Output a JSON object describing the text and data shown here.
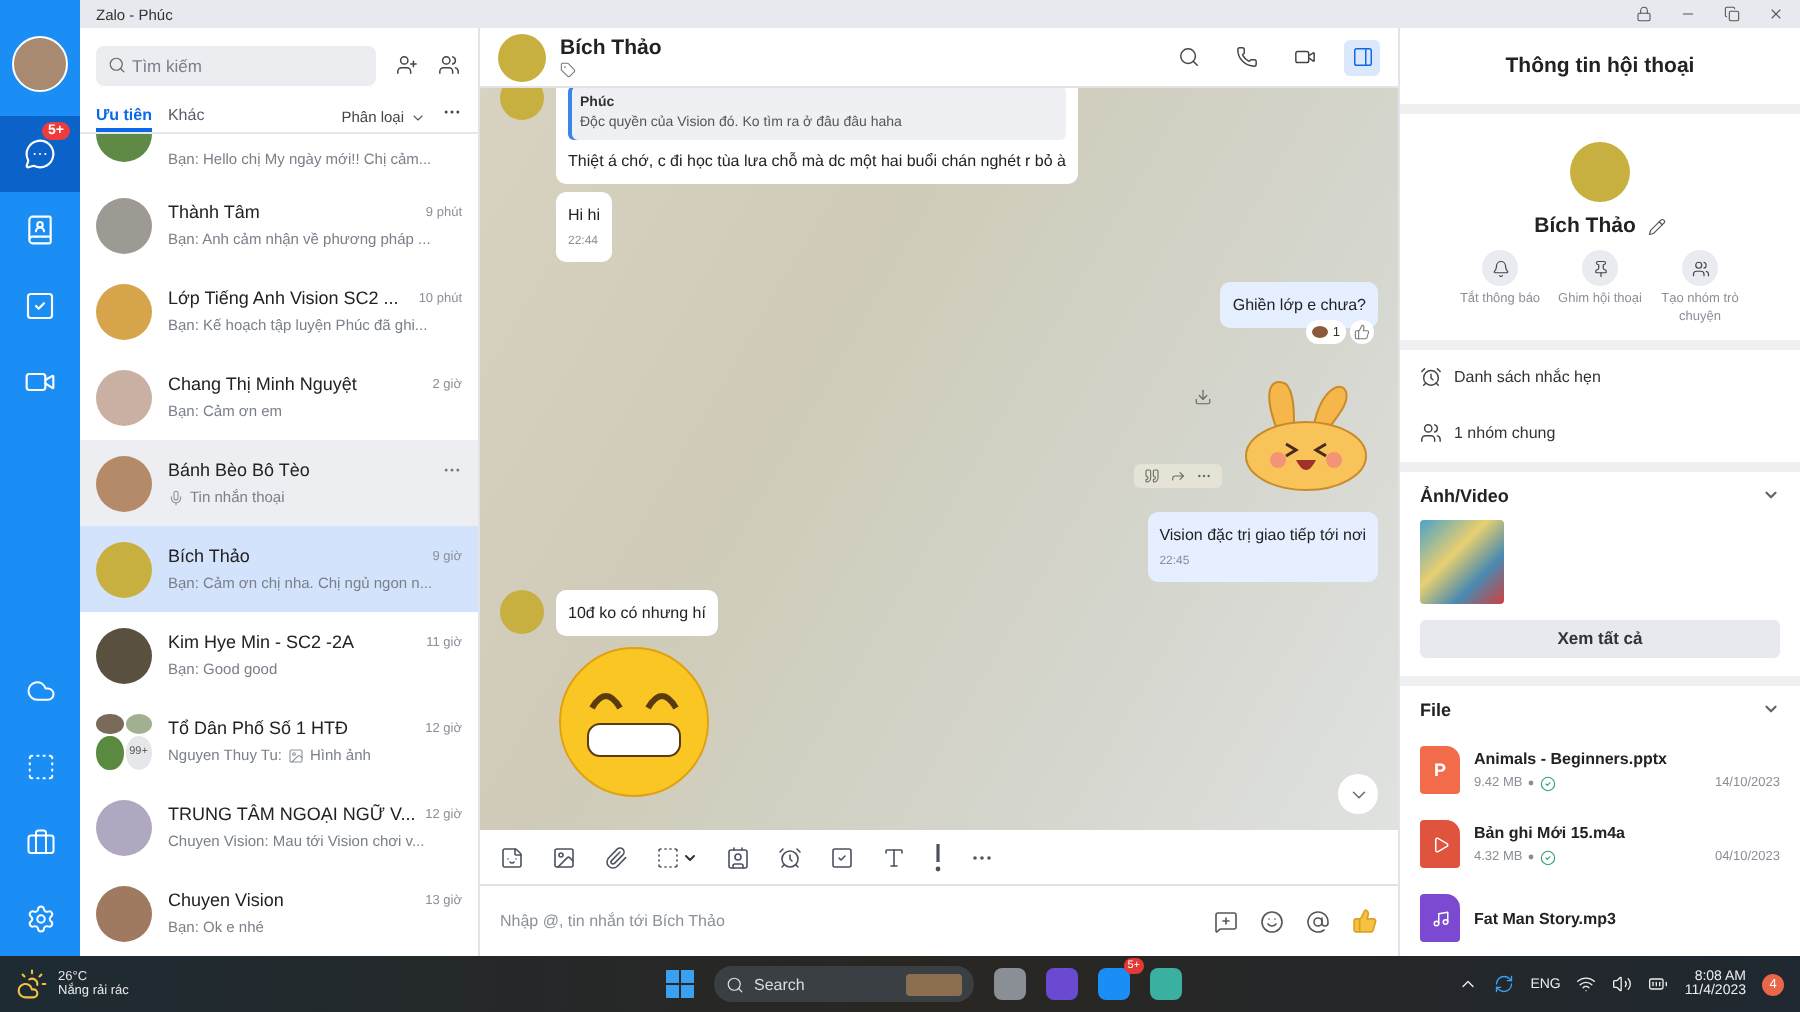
{
  "window": {
    "title": "Zalo - Phúc"
  },
  "nav": {
    "items": [
      {
        "kind": "chat",
        "selected": true,
        "badge": "5+"
      },
      {
        "kind": "contacts",
        "selected": false
      },
      {
        "kind": "todo",
        "selected": false
      },
      {
        "kind": "video",
        "selected": false
      }
    ],
    "bottom": [
      {
        "kind": "cloud"
      },
      {
        "kind": "screenshot"
      },
      {
        "kind": "toolbox"
      },
      {
        "kind": "settings"
      }
    ]
  },
  "search": {
    "placeholder": "Tìm kiếm"
  },
  "list_tabs": [
    {
      "label": "Ưu tiên",
      "selected": true
    },
    {
      "label": "Khác",
      "selected": false
    }
  ],
  "filter": {
    "label": "Phân loại"
  },
  "conversations": [
    {
      "kind": "partial",
      "preview": "Bạn: Hello chị My ngày mới!! Chị cảm...",
      "selected": false,
      "hovered": false
    },
    {
      "kind": "single",
      "name": "Thành Tâm",
      "time": "9 phút",
      "preview": "Bạn: Anh cảm nhận về phương pháp ...",
      "selected": false,
      "hovered": false
    },
    {
      "kind": "single",
      "name": "Lớp Tiếng Anh Vision SC2 ...",
      "time": "10 phút",
      "preview": "Bạn: Kế hoạch tập luyện Phúc đã ghi...",
      "selected": false,
      "hovered": false
    },
    {
      "kind": "single",
      "name": "Chang Thị Minh Nguyệt",
      "time": "2 giờ",
      "preview": "Bạn: Cảm ơn em",
      "selected": false,
      "hovered": false
    },
    {
      "kind": "single",
      "name": "Bánh Bèo Bô Tèo",
      "attachment": {
        "kind": "mic"
      },
      "preview": "Tin nhắn thoại",
      "selected": false,
      "hovered": true
    },
    {
      "kind": "single",
      "name": "Bích Thảo",
      "time": "9 giờ",
      "preview": "Bạn: Cảm ơn chị nha. Chị ngủ ngon n...",
      "selected": true,
      "hovered": false
    },
    {
      "kind": "single",
      "name": "Kim Hye Min - SC2 -2A",
      "time": "11 giờ",
      "preview": "Bạn: Good good",
      "selected": false,
      "hovered": false
    },
    {
      "kind": "group",
      "avatar_count": "99+",
      "name": "Tổ Dân Phố Số 1 HTĐ",
      "time": "12 giờ",
      "sender": "Nguyen Thuy Tu:",
      "attachment": {
        "kind": "image"
      },
      "preview": "Hình ảnh",
      "selected": false,
      "hovered": false
    },
    {
      "kind": "single",
      "name": "TRUNG TÂM NGOẠI NGỮ V...",
      "time": "12 giờ",
      "preview": "Chuyen Vision: Mau tới Vision chơi v...",
      "selected": false,
      "hovered": false
    },
    {
      "kind": "single",
      "name": "Chuyen Vision",
      "time": "13 giờ",
      "preview": "Bạn: Ok e nhé",
      "selected": false,
      "hovered": false
    }
  ],
  "chat": {
    "name": "Bích Thảo",
    "header_actions": [
      {
        "kind": "search",
        "selected": false
      },
      {
        "kind": "call",
        "selected": false
      },
      {
        "kind": "video",
        "selected": false
      },
      {
        "kind": "panel",
        "selected": true
      }
    ],
    "messages": [
      {
        "kind": "received",
        "quote": {
          "author": "Phúc",
          "text": "Độc quyền của Vision đó. Ko tìm ra ở đâu đâu haha"
        },
        "text": "Thiệt á chớ, c đi học tùa lưa chỗ mà dc một hai buổi chán nghét r bỏ à"
      },
      {
        "kind": "received",
        "text": "Hi hi",
        "time": "22:44"
      },
      {
        "kind": "sent",
        "text": "Ghiền lớp e chưa?",
        "reaction_count": "1"
      },
      {
        "kind": "sticker"
      },
      {
        "kind": "sent",
        "text": "Vision đặc trị giao tiếp tới nơi",
        "time": "22:45"
      },
      {
        "kind": "received",
        "text": "10đ ko có nhưng hí"
      },
      {
        "kind": "emoji_sticker"
      }
    ],
    "toolbar": [
      {
        "kind": "sticker"
      },
      {
        "kind": "image"
      },
      {
        "kind": "attach"
      },
      {
        "kind": "screenshot"
      },
      {
        "kind": "card"
      },
      {
        "kind": "reminder"
      },
      {
        "kind": "todo"
      },
      {
        "kind": "format"
      },
      {
        "kind": "urgent"
      },
      {
        "kind": "more"
      }
    ],
    "input": {
      "placeholder": "Nhập @, tin nhắn tới Bích Thảo"
    },
    "input_actions": [
      {
        "kind": "quick"
      },
      {
        "kind": "emoji"
      },
      {
        "kind": "mention"
      },
      {
        "kind": "like"
      }
    ]
  },
  "info": {
    "title": "Thông tin hội thoại",
    "name": "Bích Thảo",
    "actions": [
      {
        "kind": "mute",
        "label": "Tắt thông báo"
      },
      {
        "kind": "pin",
        "label": "Ghim hội thoại"
      },
      {
        "kind": "group",
        "label": "Tạo nhóm trò chuyện"
      }
    ],
    "rows": [
      {
        "kind": "reminder",
        "label": "Danh sách nhắc hẹn"
      },
      {
        "kind": "groups",
        "label": "1 nhóm chung"
      }
    ],
    "media": {
      "title": "Ảnh/Video",
      "button": "Xem tất cả"
    },
    "files": {
      "title": "File",
      "items": [
        {
          "kind": "pptx",
          "icon_letter": "P",
          "name": "Animals - Beginners.pptx",
          "size": "9.42 MB",
          "date": "14/10/2023"
        },
        {
          "kind": "audio",
          "name": "Bản ghi Mới 15.m4a",
          "size": "4.32 MB",
          "date": "04/10/2023"
        },
        {
          "kind": "music",
          "name": "Fat Man Story.mp3"
        }
      ]
    }
  },
  "taskbar": {
    "weather": {
      "temp": "26°C",
      "desc": "Nắng rải rác"
    },
    "search": "Search",
    "apps": [
      {
        "kind": "taskview"
      },
      {
        "kind": "meet"
      },
      {
        "kind": "zalo",
        "badge": "5+"
      },
      {
        "kind": "browser"
      }
    ],
    "lang": "ENG",
    "time": "8:08 AM",
    "date": "11/4/2023",
    "notifications": "4"
  }
}
